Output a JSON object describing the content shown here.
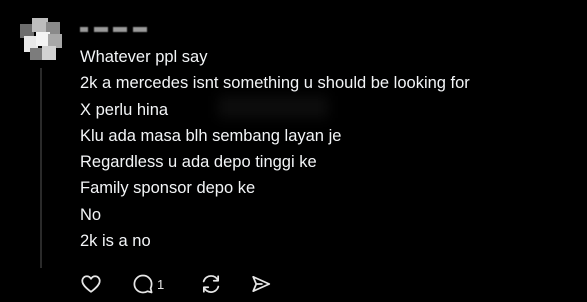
{
  "post": {
    "lines": [
      "Whatever ppl say",
      "2k a mercedes isnt something u should be looking for",
      "X perlu hina",
      "Klu ada masa blh sembang layan je",
      "Regardless u ada depo tinggi ke",
      "Family sponsor depo ke",
      "No",
      "2k is a no"
    ]
  },
  "actions": {
    "reply_count": "1",
    "icons": [
      "heart-icon",
      "comment-icon",
      "repost-icon",
      "share-icon"
    ]
  },
  "colors": {
    "background": "#000000",
    "text": "#f3f5f7",
    "thread_line": "#2a2a2a"
  }
}
